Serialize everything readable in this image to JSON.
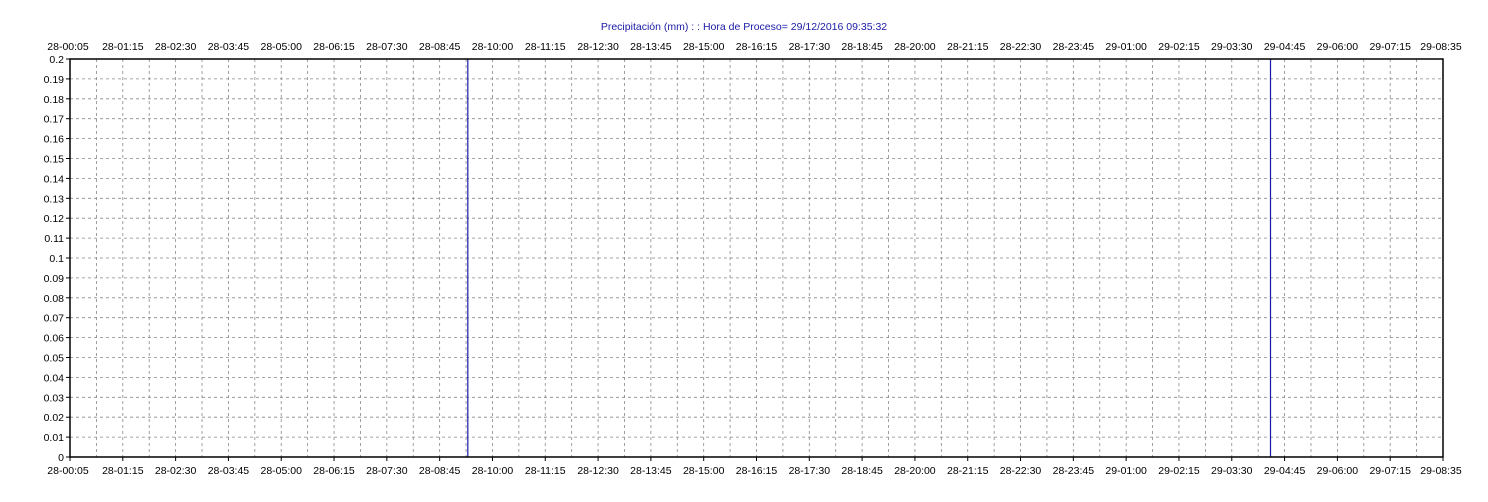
{
  "chart_data": {
    "type": "line",
    "title": "Precipitación  (mm) : : Hora de Proceso= 29/12/2016 09:35:32",
    "xlabel": "",
    "ylabel": "",
    "x_tick_labels": [
      "28-00:05",
      "28-01:15",
      "28-02:30",
      "28-03:45",
      "28-05:00",
      "28-06:15",
      "28-07:30",
      "28-08:45",
      "28-10:00",
      "28-11:15",
      "28-12:30",
      "28-13:45",
      "28-15:00",
      "28-16:15",
      "28-17:30",
      "28-18:45",
      "28-20:00",
      "28-21:15",
      "28-22:30",
      "28-23:45",
      "29-01:00",
      "29-02:15",
      "29-03:30",
      "29-04:45",
      "29-06:00",
      "29-07:15",
      "29-08:35"
    ],
    "y_tick_labels": [
      "0",
      "0.01",
      "0.02",
      "0.03",
      "0.04",
      "0.05",
      "0.06",
      "0.07",
      "0.08",
      "0.09",
      "0.1",
      "0.11",
      "0.12",
      "0.13",
      "0.14",
      "0.15",
      "0.16",
      "0.17",
      "0.18",
      "0.19",
      "0.2"
    ],
    "ylim": [
      0,
      0.2
    ],
    "grid": true,
    "series": [
      {
        "values": [
          0
        ],
        "color": "#1a1aa6"
      }
    ],
    "vertical_markers": [
      {
        "x": "28-09:30",
        "color": "#1a1aa6"
      },
      {
        "x": "29-04:30",
        "color": "#1a1aa6"
      }
    ]
  }
}
